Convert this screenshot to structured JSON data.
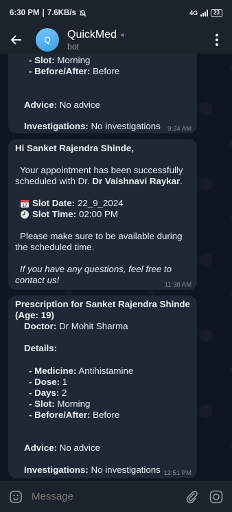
{
  "status_bar": {
    "time": "6:30 PM",
    "speed": "7.6KB/s",
    "network": "4G",
    "battery": "23"
  },
  "header": {
    "avatar_letter": "Q",
    "title": "QuickMed",
    "subtitle": "bot"
  },
  "messages": [
    {
      "lines": [
        {
          "label": "- Slot:",
          "value": " Morning"
        },
        {
          "label": "- Before/After:",
          "value": " Before"
        },
        {
          "label": "Advice:",
          "value": " No advice"
        },
        {
          "label": "Investigations:",
          "value": " No investigations"
        }
      ],
      "time": "9:24 AM"
    },
    {
      "greeting": "Hi Sanket Rajendra Shinde,",
      "body_1": "Your appointment has been successfully",
      "body_2a": "scheduled with Dr. ",
      "body_2b": "Dr Vaishnavi Raykar",
      "body_2c": ".",
      "slot_date_label": "Slot Date:",
      "slot_date_value": " 22_9_2024",
      "slot_time_label": "Slot Time:",
      "slot_time_value": " 02:00 PM",
      "note_1": "Please make sure to be available during",
      "note_2": "the scheduled time.",
      "closing_1": "If you have any questions, feel free to",
      "closing_2": "contact us!",
      "time": "11:38 AM"
    },
    {
      "title_1": "Prescription for Sanket Rajendra Shinde",
      "title_2": "(Age: 19)",
      "doctor_label": "Doctor:",
      "doctor_value": " Dr Mohit Sharma",
      "details_label": "Details:",
      "medicine_label": "- Medicine:",
      "medicine_value": " Antihistamine",
      "dose_label": "- Dose:",
      "dose_value": " 1",
      "days_label": "- Days:",
      "days_value": " 2",
      "slot_label": "- Slot:",
      "slot_value": " Morning",
      "ba_label": "- Before/After:",
      "ba_value": " Before",
      "advice_label": "Advice:",
      "advice_value": " No advice",
      "inv_label": "Investigations:",
      "inv_value": " No investigations",
      "time": "12:51 PM"
    }
  ],
  "input": {
    "placeholder": "Message"
  }
}
